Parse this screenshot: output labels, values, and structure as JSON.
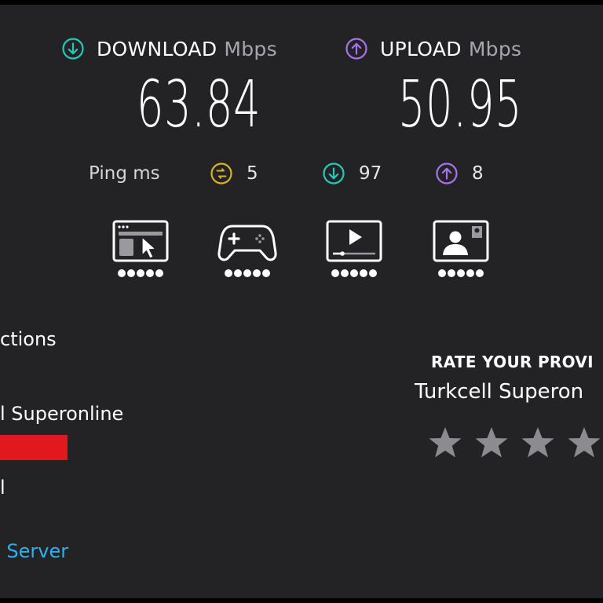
{
  "download": {
    "label": "DOWNLOAD",
    "unit": "Mbps",
    "value": "63.84",
    "icon": "download-arrow-icon",
    "color": "#28c8b7"
  },
  "upload": {
    "label": "UPLOAD",
    "unit": "Mbps",
    "value": "50.95",
    "icon": "upload-arrow-icon",
    "color": "#a872e8"
  },
  "ping": {
    "label": "Ping",
    "unit": "ms",
    "idle": "5",
    "idle_color": "#d6b22a",
    "download_latency": "97",
    "upload_latency": "8"
  },
  "usage_ratings": [
    {
      "name": "web-browsing",
      "icon": "web-browsing-icon",
      "dots": 5
    },
    {
      "name": "gaming",
      "icon": "gamepad-icon",
      "dots": 5
    },
    {
      "name": "video-streaming",
      "icon": "video-player-icon",
      "dots": 5
    },
    {
      "name": "video-chat",
      "icon": "video-call-icon",
      "dots": 5
    }
  ],
  "connection": {
    "heading": "ctions",
    "provider": "l Superonline",
    "server": "l",
    "change_server": "e Server"
  },
  "rate_provider": {
    "title": "RATE YOUR PROVI",
    "provider": "Turkcell Superon",
    "stars": 4
  }
}
